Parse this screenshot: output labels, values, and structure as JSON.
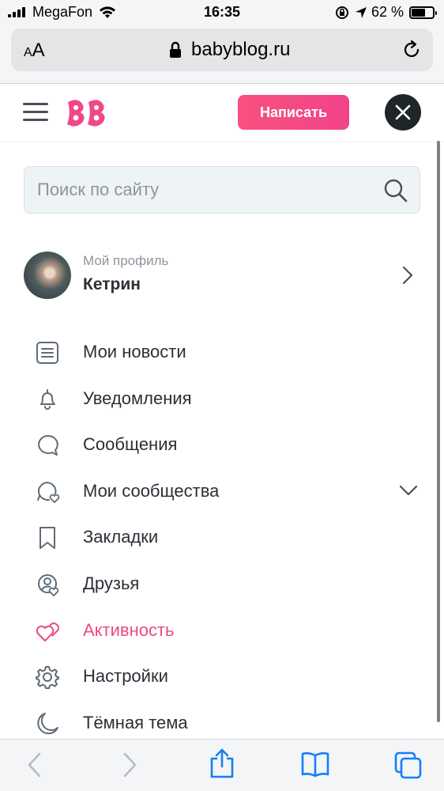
{
  "status_bar": {
    "carrier": "MegaFon",
    "time": "16:35",
    "battery": "62 %",
    "battery_level": 0.62
  },
  "browser": {
    "text_size_label_small": "A",
    "text_size_label_large": "A",
    "url": "babyblog.ru"
  },
  "header": {
    "write_button": "Написать"
  },
  "search": {
    "placeholder": "Поиск по сайту"
  },
  "profile": {
    "caption": "Мой профиль",
    "name": "Кетрин"
  },
  "menu": {
    "items": [
      {
        "label": "Мои новости",
        "icon": "news-icon"
      },
      {
        "label": "Уведомления",
        "icon": "bell-icon"
      },
      {
        "label": "Сообщения",
        "icon": "chat-bubble-icon"
      },
      {
        "label": "Мои сообщества",
        "icon": "community-heart-icon"
      },
      {
        "label": "Закладки",
        "icon": "bookmark-icon"
      },
      {
        "label": "Друзья",
        "icon": "friends-icon"
      },
      {
        "label": "Активность",
        "icon": "hearts-icon"
      },
      {
        "label": "Настройки",
        "icon": "gear-icon"
      },
      {
        "label": "Тёмная тема",
        "icon": "moon-icon"
      }
    ]
  },
  "colors": {
    "accent_pink": "#f2438a",
    "active_text": "#ea4a86",
    "toolbar_blue": "#147efb"
  }
}
